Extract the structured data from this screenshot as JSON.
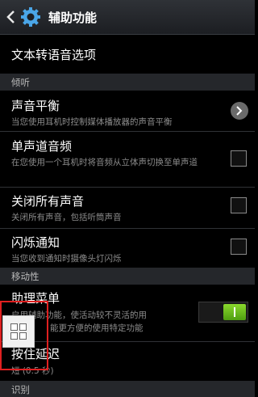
{
  "header": {
    "title": "辅助功能"
  },
  "items": {
    "tts": {
      "label": "文本转语音选项"
    },
    "sound_balance": {
      "label": "声音平衡",
      "desc": "当您使用耳机时控制媒体播放器的声音平衡"
    },
    "mono_audio": {
      "label": "单声道音频",
      "desc": "在您使用一个耳机时将音频从立体声切换至单声道"
    },
    "mute_all": {
      "label": "关闭所有声音",
      "desc": "关闭所有声音，包括听筒声音"
    },
    "flash_notify": {
      "label": "闪烁通知",
      "desc": "当您收到通知时摄像头灯闪烁"
    },
    "assistant_menu": {
      "label": "助理菜单",
      "desc_line1": "启用辅助功能，使活动较不灵活的用",
      "desc_line2": "能更方便的使用特定功能"
    },
    "press_delay": {
      "label": "按住延迟",
      "value": "短 (0.5 秒)"
    }
  },
  "sections": {
    "hearing": "倾听",
    "mobility": "移动性",
    "recognition": "识别"
  },
  "colors": {
    "toggle_on": "#6cc31e",
    "highlight_box": "#e02020",
    "section_bg": "#25272b"
  }
}
